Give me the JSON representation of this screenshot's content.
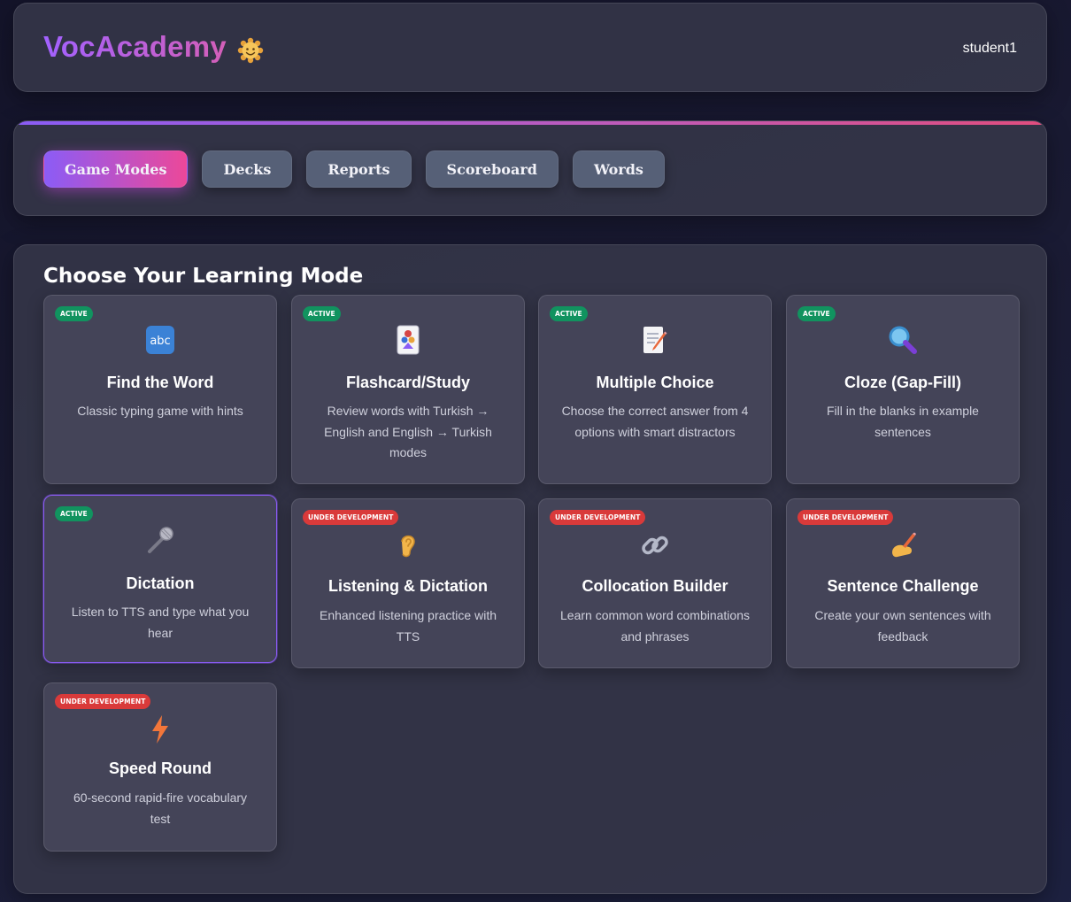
{
  "header": {
    "brand": "VocAcademy",
    "brand_icon": "smiling-face-icon",
    "username": "student1"
  },
  "nav": {
    "items": [
      {
        "label": "Game Modes",
        "active": true
      },
      {
        "label": "Decks",
        "active": false
      },
      {
        "label": "Reports",
        "active": false
      },
      {
        "label": "Scoreboard",
        "active": false
      },
      {
        "label": "Words",
        "active": false
      }
    ]
  },
  "main": {
    "title": "Choose Your Learning Mode",
    "badges": {
      "active": "ACTIVE",
      "dev": "UNDER DEVELOPMENT"
    },
    "modes": [
      {
        "title": "Find the Word",
        "desc": "Classic typing game with hints",
        "status": "ACTIVE",
        "icon": "abc-icon"
      },
      {
        "title": "Flashcard/Study",
        "desc": "Review words with Turkish → English and English → Turkish modes",
        "status": "ACTIVE",
        "icon": "playing-card-icon"
      },
      {
        "title": "Multiple Choice",
        "desc": "Choose the correct answer from 4 options with smart distractors",
        "status": "ACTIVE",
        "icon": "memo-icon"
      },
      {
        "title": "Cloze (Gap-Fill)",
        "desc": "Fill in the blanks in example sentences",
        "status": "ACTIVE",
        "icon": "magnifier-icon"
      },
      {
        "title": "Dictation",
        "desc": "Listen to TTS and type what you hear",
        "status": "ACTIVE",
        "icon": "microphone-icon"
      },
      {
        "title": "Listening & Dictation",
        "desc": "Enhanced listening practice with TTS",
        "status": "UNDER DEVELOPMENT",
        "icon": "ear-icon"
      },
      {
        "title": "Collocation Builder",
        "desc": "Learn common word combinations and phrases",
        "status": "UNDER DEVELOPMENT",
        "icon": "link-icon"
      },
      {
        "title": "Sentence Challenge",
        "desc": "Create your own sentences with feedback",
        "status": "UNDER DEVELOPMENT",
        "icon": "writing-hand-icon"
      },
      {
        "title": "Speed Round",
        "desc": "60-second rapid-fire vocabulary test",
        "status": "UNDER DEVELOPMENT",
        "icon": "lightning-icon"
      }
    ]
  },
  "colors": {
    "accent_start": "#8b5cf6",
    "accent_end": "#ec4899",
    "active_badge": "#11935f",
    "dev_badge": "#d93a3a",
    "nav_button": "#566077"
  }
}
